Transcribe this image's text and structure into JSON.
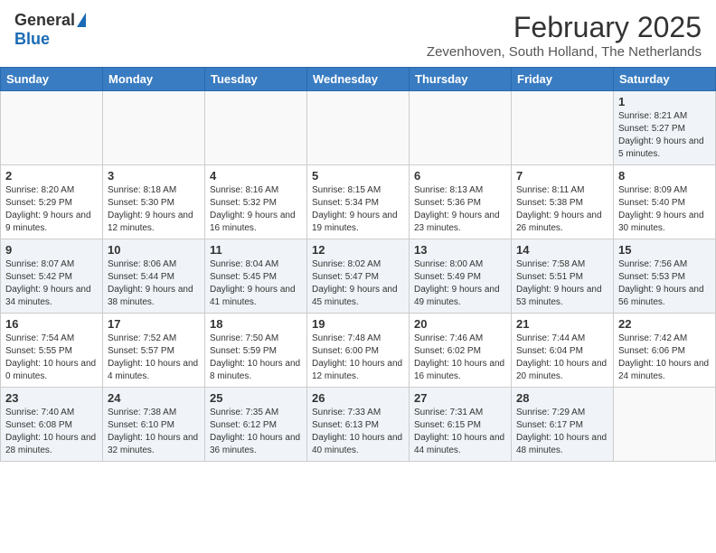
{
  "header": {
    "logo_general": "General",
    "logo_blue": "Blue",
    "month_title": "February 2025",
    "location": "Zevenhoven, South Holland, The Netherlands"
  },
  "days_of_week": [
    "Sunday",
    "Monday",
    "Tuesday",
    "Wednesday",
    "Thursday",
    "Friday",
    "Saturday"
  ],
  "weeks": [
    [
      {
        "day": "",
        "info": ""
      },
      {
        "day": "",
        "info": ""
      },
      {
        "day": "",
        "info": ""
      },
      {
        "day": "",
        "info": ""
      },
      {
        "day": "",
        "info": ""
      },
      {
        "day": "",
        "info": ""
      },
      {
        "day": "1",
        "info": "Sunrise: 8:21 AM\nSunset: 5:27 PM\nDaylight: 9 hours and 5 minutes."
      }
    ],
    [
      {
        "day": "2",
        "info": "Sunrise: 8:20 AM\nSunset: 5:29 PM\nDaylight: 9 hours and 9 minutes."
      },
      {
        "day": "3",
        "info": "Sunrise: 8:18 AM\nSunset: 5:30 PM\nDaylight: 9 hours and 12 minutes."
      },
      {
        "day": "4",
        "info": "Sunrise: 8:16 AM\nSunset: 5:32 PM\nDaylight: 9 hours and 16 minutes."
      },
      {
        "day": "5",
        "info": "Sunrise: 8:15 AM\nSunset: 5:34 PM\nDaylight: 9 hours and 19 minutes."
      },
      {
        "day": "6",
        "info": "Sunrise: 8:13 AM\nSunset: 5:36 PM\nDaylight: 9 hours and 23 minutes."
      },
      {
        "day": "7",
        "info": "Sunrise: 8:11 AM\nSunset: 5:38 PM\nDaylight: 9 hours and 26 minutes."
      },
      {
        "day": "8",
        "info": "Sunrise: 8:09 AM\nSunset: 5:40 PM\nDaylight: 9 hours and 30 minutes."
      }
    ],
    [
      {
        "day": "9",
        "info": "Sunrise: 8:07 AM\nSunset: 5:42 PM\nDaylight: 9 hours and 34 minutes."
      },
      {
        "day": "10",
        "info": "Sunrise: 8:06 AM\nSunset: 5:44 PM\nDaylight: 9 hours and 38 minutes."
      },
      {
        "day": "11",
        "info": "Sunrise: 8:04 AM\nSunset: 5:45 PM\nDaylight: 9 hours and 41 minutes."
      },
      {
        "day": "12",
        "info": "Sunrise: 8:02 AM\nSunset: 5:47 PM\nDaylight: 9 hours and 45 minutes."
      },
      {
        "day": "13",
        "info": "Sunrise: 8:00 AM\nSunset: 5:49 PM\nDaylight: 9 hours and 49 minutes."
      },
      {
        "day": "14",
        "info": "Sunrise: 7:58 AM\nSunset: 5:51 PM\nDaylight: 9 hours and 53 minutes."
      },
      {
        "day": "15",
        "info": "Sunrise: 7:56 AM\nSunset: 5:53 PM\nDaylight: 9 hours and 56 minutes."
      }
    ],
    [
      {
        "day": "16",
        "info": "Sunrise: 7:54 AM\nSunset: 5:55 PM\nDaylight: 10 hours and 0 minutes."
      },
      {
        "day": "17",
        "info": "Sunrise: 7:52 AM\nSunset: 5:57 PM\nDaylight: 10 hours and 4 minutes."
      },
      {
        "day": "18",
        "info": "Sunrise: 7:50 AM\nSunset: 5:59 PM\nDaylight: 10 hours and 8 minutes."
      },
      {
        "day": "19",
        "info": "Sunrise: 7:48 AM\nSunset: 6:00 PM\nDaylight: 10 hours and 12 minutes."
      },
      {
        "day": "20",
        "info": "Sunrise: 7:46 AM\nSunset: 6:02 PM\nDaylight: 10 hours and 16 minutes."
      },
      {
        "day": "21",
        "info": "Sunrise: 7:44 AM\nSunset: 6:04 PM\nDaylight: 10 hours and 20 minutes."
      },
      {
        "day": "22",
        "info": "Sunrise: 7:42 AM\nSunset: 6:06 PM\nDaylight: 10 hours and 24 minutes."
      }
    ],
    [
      {
        "day": "23",
        "info": "Sunrise: 7:40 AM\nSunset: 6:08 PM\nDaylight: 10 hours and 28 minutes."
      },
      {
        "day": "24",
        "info": "Sunrise: 7:38 AM\nSunset: 6:10 PM\nDaylight: 10 hours and 32 minutes."
      },
      {
        "day": "25",
        "info": "Sunrise: 7:35 AM\nSunset: 6:12 PM\nDaylight: 10 hours and 36 minutes."
      },
      {
        "day": "26",
        "info": "Sunrise: 7:33 AM\nSunset: 6:13 PM\nDaylight: 10 hours and 40 minutes."
      },
      {
        "day": "27",
        "info": "Sunrise: 7:31 AM\nSunset: 6:15 PM\nDaylight: 10 hours and 44 minutes."
      },
      {
        "day": "28",
        "info": "Sunrise: 7:29 AM\nSunset: 6:17 PM\nDaylight: 10 hours and 48 minutes."
      },
      {
        "day": "",
        "info": ""
      }
    ]
  ]
}
